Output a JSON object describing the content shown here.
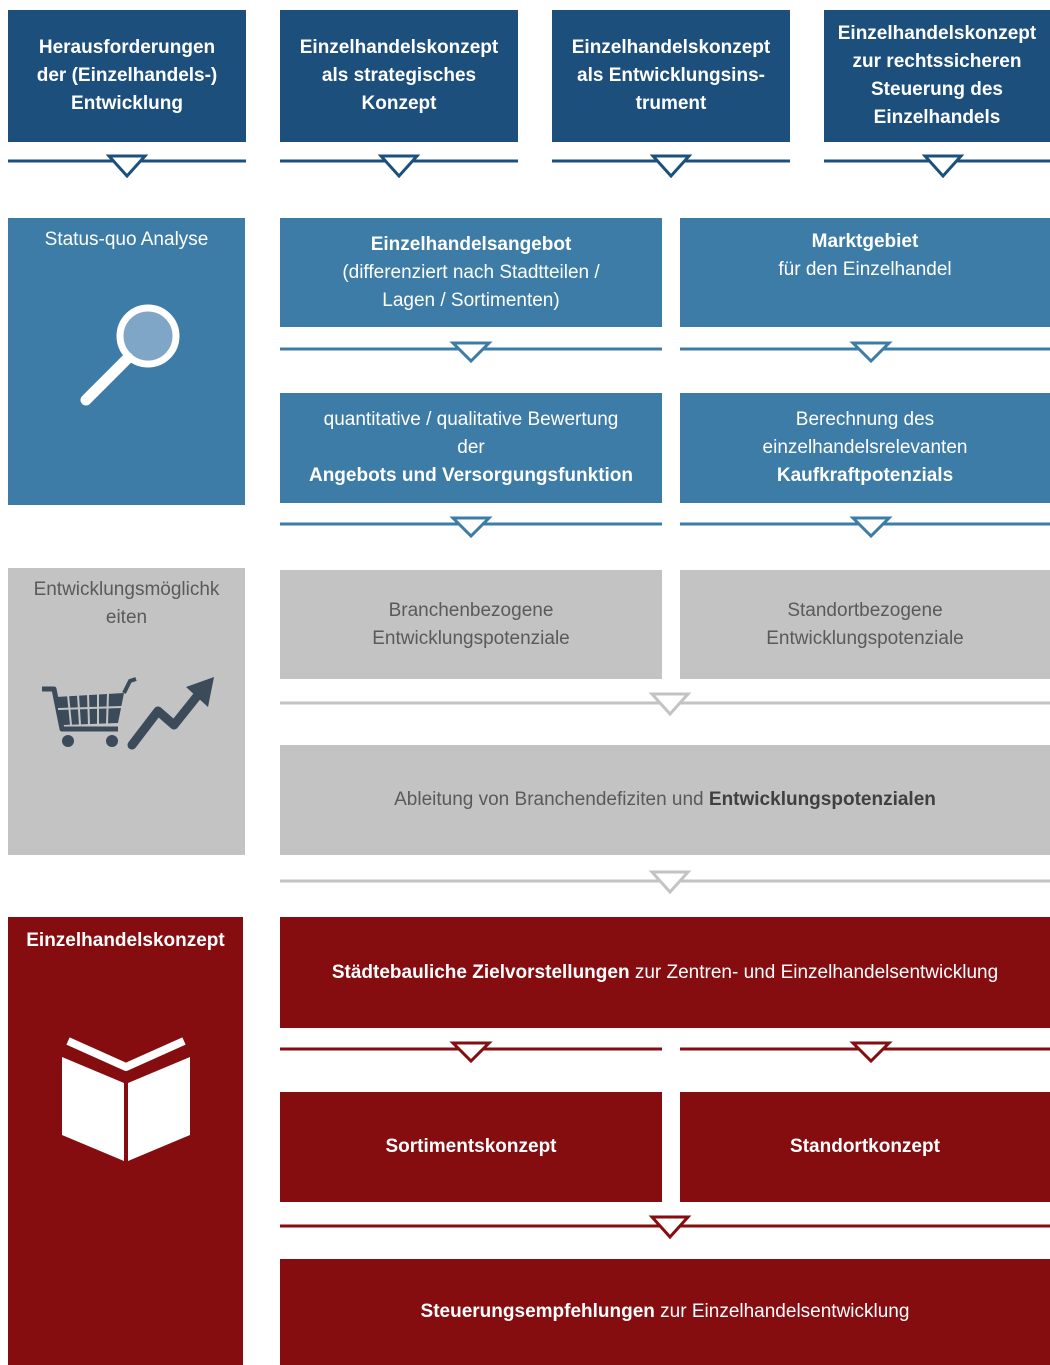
{
  "top_row": [
    {
      "l1": "Herausforderungen",
      "l2": "der (Einzelhandels-)",
      "l3": "Entwicklung"
    },
    {
      "l1": "Einzelhandelskonzept",
      "l2": "als strategisches",
      "l3": "Konzept"
    },
    {
      "l1": "Einzelhandelskonzept",
      "l2": "als Entwicklungsins-",
      "l3": "trument"
    },
    {
      "l1": "Einzelhandelskonzept",
      "l2": "zur rechtssicheren",
      "l3": "Steuerung des",
      "l4": "Einzelhandels"
    }
  ],
  "status_quo": {
    "title": "Status-quo Analyse",
    "angebot": {
      "bold": "Einzelhandelsangebot",
      "l2": "(differenziert nach Stadtteilen /",
      "l3": "Lagen / Sortimenten)"
    },
    "marktgebiet": {
      "bold": "Marktgebiet",
      "l2": "für den Einzelhandel"
    },
    "bewertung": {
      "l1": "quantitative / qualitative Bewertung",
      "l2": "der",
      "bold": "Angebots und Versorgungsfunktion"
    },
    "kaufkraft": {
      "l1": "Berechnung des",
      "l2": "einzelhandelsrelevanten",
      "bold": "Kaufkraftpotenzials"
    }
  },
  "entwicklung": {
    "title_l1": "Entwicklungsmöglichk",
    "title_l2": "eiten",
    "branchen": {
      "l1": "Branchenbezogene",
      "l2": "Entwicklungspotenziale"
    },
    "standort": {
      "l1": "Standortbezogene",
      "l2": "Entwicklungspotenziale"
    },
    "ableitung": {
      "normal": "Ableitung von Branchendefiziten und ",
      "bold": "Entwicklungspotenzialen"
    }
  },
  "konzept": {
    "title": "Einzelhandelskonzept",
    "ziel": {
      "bold": "Städtebauliche Zielvorstellungen",
      "normal": " zur Zentren- und Einzelhandelsentwicklung"
    },
    "sortiment": "Sortimentskonzept",
    "standort": "Standortkonzept",
    "steuerung": {
      "bold": "Steuerungsempfehlungen",
      "normal": " zur Einzelhandelsentwicklung"
    }
  },
  "icons": {
    "status": "magnifier-icon",
    "entwicklung_cart": "shopping-cart-icon",
    "entwicklung_trend": "trend-arrow-icon",
    "konzept": "open-book-icon"
  },
  "colors": {
    "navy": "#1d4f7c",
    "blue": "#3d7ca6",
    "grey": "#c3c3c3",
    "red": "#850d10"
  }
}
